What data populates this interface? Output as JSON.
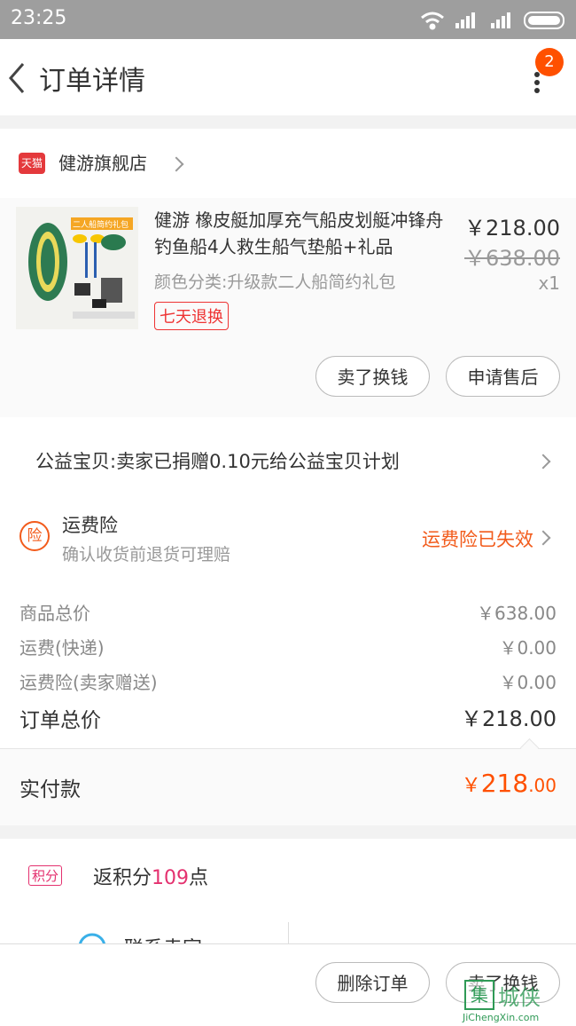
{
  "status_bar": {
    "time": "23:25"
  },
  "header": {
    "title": "订单详情",
    "badge_count": "2"
  },
  "shop": {
    "badge": "天猫",
    "name": "健游旗舰店"
  },
  "item": {
    "title": "健游 橡皮艇加厚充气船皮划艇冲锋舟钓鱼船4人救生船气垫船+礼品",
    "spec": "颜色分类:升级款二人船简约礼包",
    "return_tag": "七天退换",
    "price": "￥218.00",
    "original_price": "￥638.00",
    "quantity": "x1",
    "thumb_label": "二人船简约礼包",
    "actions": {
      "sell": "卖了换钱",
      "after_sale": "申请售后"
    }
  },
  "charity": {
    "text": "公益宝贝:卖家已捐赠0.10元给公益宝贝计划"
  },
  "insurance": {
    "icon_text": "险",
    "title": "运费险",
    "subtitle": "确认收货前退货可理赔",
    "status": "运费险已失效"
  },
  "summary": {
    "goods_total_label": "商品总价",
    "goods_total": "￥638.00",
    "shipping_label": "运费(快递)",
    "shipping": "￥0.00",
    "insurance_label": "运费险(卖家赠送)",
    "insurance": "￥0.00",
    "order_total_label": "订单总价",
    "order_total": "￥218.00"
  },
  "paid": {
    "label": "实付款",
    "currency": "￥",
    "int": "218",
    "dec": ".00"
  },
  "points": {
    "tag": "积分",
    "prefix": "返积分",
    "value": "109",
    "suffix": "点"
  },
  "contact": {
    "label": "联系卖家"
  },
  "footer": {
    "delete": "删除订单",
    "sell": "卖了换钱"
  },
  "watermark": {
    "logo": "集",
    "name": "城侠",
    "url": "JiChengXin.com"
  },
  "colors": {
    "accent": "#ff5000",
    "red": "#e4393c",
    "points": "#e4316f"
  }
}
